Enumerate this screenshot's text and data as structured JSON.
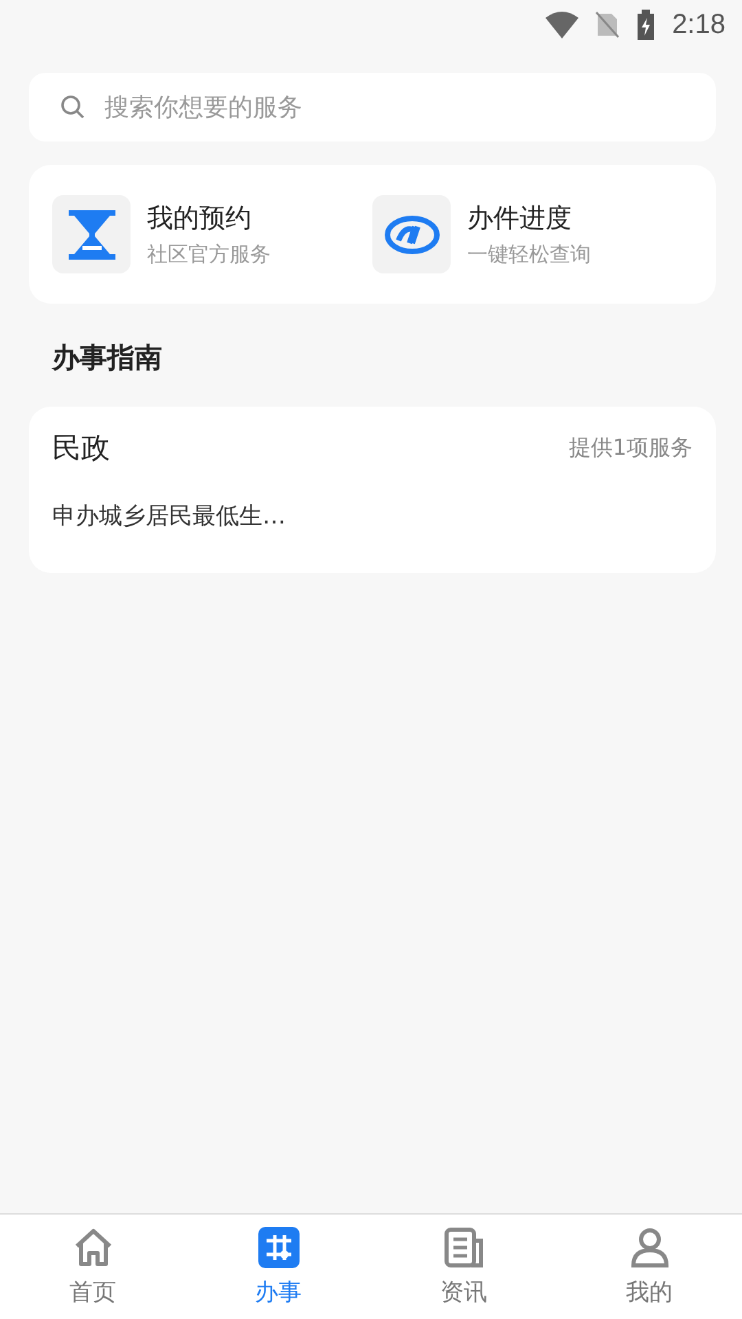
{
  "status_bar": {
    "time": "2:18"
  },
  "search": {
    "placeholder": "搜索你想要的服务"
  },
  "shortcuts": [
    {
      "kind": "hourglass",
      "title": "我的预约",
      "subtitle": "社区官方服务"
    },
    {
      "kind": "si",
      "title": "办件进度",
      "subtitle": "一键轻松查询"
    }
  ],
  "guide": {
    "heading": "办事指南",
    "categories": [
      {
        "name": "民政",
        "count": "提供1项服务",
        "items": [
          "申办城乡居民最低生…"
        ]
      }
    ]
  },
  "tabs": [
    {
      "kind": "home",
      "label": "首页",
      "selected": false
    },
    {
      "kind": "task",
      "label": "办事",
      "selected": true
    },
    {
      "kind": "news",
      "label": "资讯",
      "selected": false
    },
    {
      "kind": "user",
      "label": "我的",
      "selected": false
    }
  ]
}
